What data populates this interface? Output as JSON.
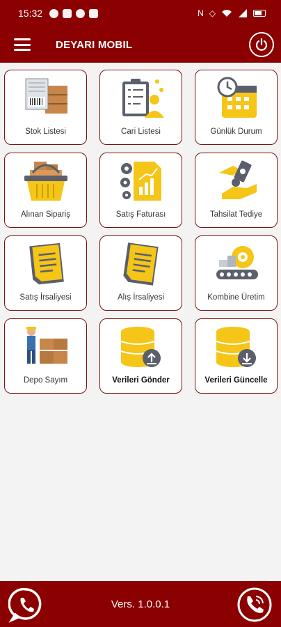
{
  "status": {
    "time": "15:32"
  },
  "header": {
    "title": "DEYARI MOBIL"
  },
  "tiles": [
    {
      "label": "Stok Listesi",
      "icon": "stock-list-icon"
    },
    {
      "label": "Cari Listesi",
      "icon": "customer-list-icon"
    },
    {
      "label": "Günlük Durum",
      "icon": "daily-status-icon"
    },
    {
      "label": "Alınan Sipariş",
      "icon": "order-basket-icon"
    },
    {
      "label": "Satış Faturası",
      "icon": "sales-invoice-icon"
    },
    {
      "label": "Tahsilat Tediye",
      "icon": "payment-icon"
    },
    {
      "label": "Satış İrsaliyesi",
      "icon": "sales-waybill-icon"
    },
    {
      "label": "Alış İrsaliyesi",
      "icon": "purchase-waybill-icon"
    },
    {
      "label": "Kombine Üretim",
      "icon": "production-icon"
    },
    {
      "label": "Depo Sayım",
      "icon": "warehouse-count-icon"
    },
    {
      "label": "Verileri Gönder",
      "icon": "database-upload-icon"
    },
    {
      "label": "Verileri Güncelle",
      "icon": "database-download-icon"
    }
  ],
  "footer": {
    "version": "Vers. 1.0.0.1"
  },
  "colors": {
    "brand": "#8b0000",
    "accent": "#f5c518",
    "tile_border": "#7a1010"
  }
}
